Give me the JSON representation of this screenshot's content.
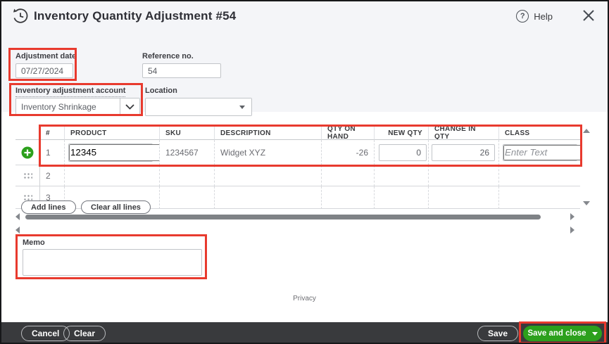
{
  "header": {
    "title": "Inventory Quantity Adjustment #54",
    "help_label": "Help"
  },
  "form": {
    "adjustment_date": {
      "label": "Adjustment date",
      "value": "07/27/2024"
    },
    "reference_no": {
      "label": "Reference no.",
      "value": "54"
    },
    "inventory_adjustment_account": {
      "label": "Inventory adjustment account",
      "value": "Inventory Shrinkage"
    },
    "location": {
      "label": "Location",
      "value": ""
    }
  },
  "table": {
    "columns": [
      "#",
      "PRODUCT",
      "SKU",
      "DESCRIPTION",
      "QTY ON HAND",
      "NEW QTY",
      "CHANGE IN QTY",
      "CLASS"
    ],
    "rows": [
      {
        "num": "1",
        "product": "12345",
        "sku": "1234567",
        "description": "Widget XYZ",
        "qty_on_hand": "-26",
        "new_qty": "0",
        "change_in_qty": "26",
        "class_placeholder": "Enter Text"
      },
      {
        "num": "2"
      },
      {
        "num": "3"
      }
    ],
    "add_lines_label": "Add lines",
    "clear_all_lines_label": "Clear all lines"
  },
  "memo": {
    "label": "Memo",
    "value": ""
  },
  "privacy_label": "Privacy",
  "footer": {
    "cancel_label": "Cancel",
    "clear_label": "Clear",
    "save_label": "Save",
    "save_and_close_label": "Save and close"
  },
  "icons": {
    "history": "clock-history",
    "help_glyph": "?",
    "close": "x-mark",
    "add_row": "plus-circle",
    "drag_handle": "grip-dots",
    "dropdown": "chevron-down"
  },
  "colors": {
    "accent_green": "#2ca01c",
    "highlight_red": "#e83a2e",
    "footer_bg": "#393a3d",
    "panel_bg": "#f4f5f8"
  }
}
